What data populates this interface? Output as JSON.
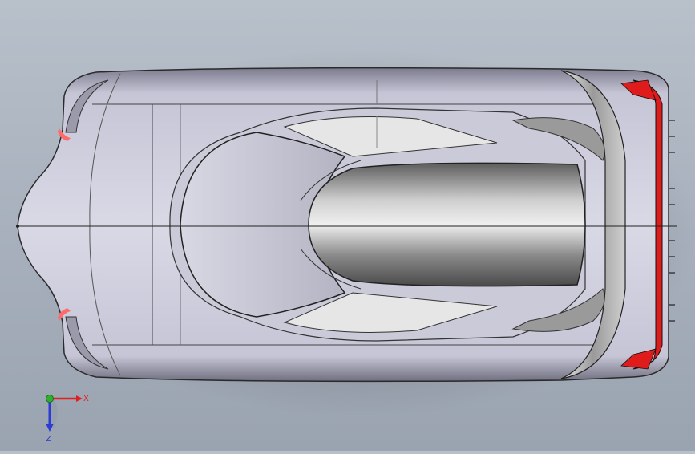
{
  "viewport": {
    "background_top": "#b8c0ca",
    "background_bottom": "#9aa3b0"
  },
  "model": {
    "body_color": "#c9c9d6",
    "canopy_color": "#d8d8dc",
    "accent_color": "#e01b1b"
  },
  "triad": {
    "x_label": "X",
    "z_label": "Z",
    "x_color": "#e02020",
    "y_color": "#2fb12f",
    "z_color": "#2b3bd6"
  }
}
